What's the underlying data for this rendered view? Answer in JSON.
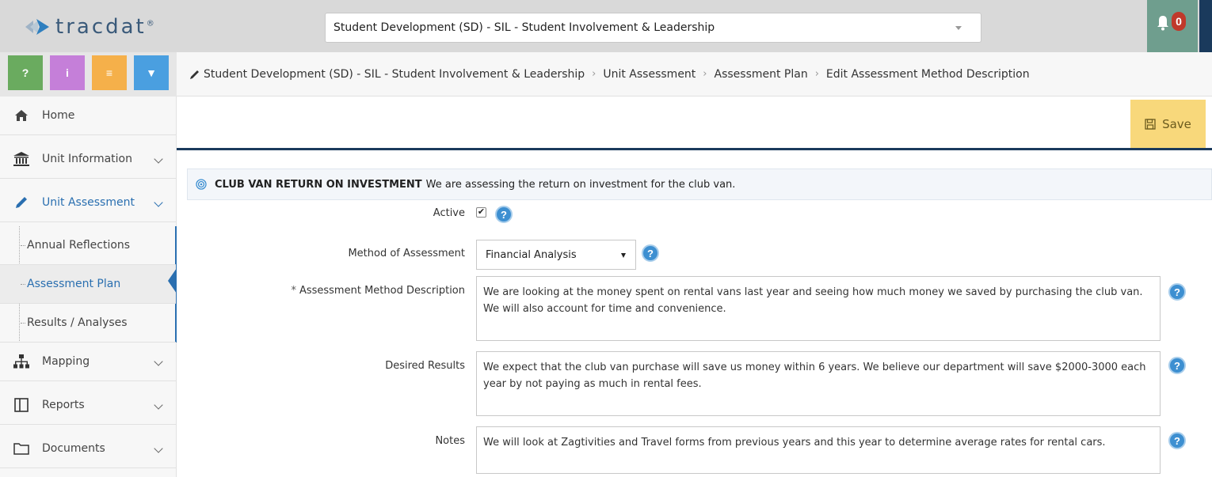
{
  "app": {
    "name": "tracdat",
    "trademark": "®"
  },
  "unit_selector": {
    "value": "Student Development (SD) - SIL - Student Involvement & Leadership"
  },
  "notifications": {
    "count": "0"
  },
  "quick_buttons": [
    {
      "label": "?",
      "color": "#6aab5f"
    },
    {
      "label": "i",
      "color": "#c57fd9"
    },
    {
      "label": "≡",
      "color": "#f5b04a"
    },
    {
      "label": "▼",
      "color": "#4a9fe0"
    }
  ],
  "sidebar": {
    "home": "Home",
    "unit_information": "Unit Information",
    "unit_assessment": "Unit Assessment",
    "sub_items": [
      "Annual Reflections",
      "Assessment Plan",
      "Results / Analyses"
    ],
    "mapping": "Mapping",
    "reports": "Reports",
    "documents": "Documents"
  },
  "breadcrumb": [
    "Student Development (SD) - SIL - Student Involvement & Leadership",
    "Unit Assessment",
    "Assessment Plan",
    "Edit Assessment Method Description"
  ],
  "toolbar": {
    "save_label": "Save"
  },
  "method": {
    "name": "CLUB VAN RETURN ON INVESTMENT",
    "description": "We are assessing the return on investment for the club van."
  },
  "form": {
    "active_label": "Active",
    "active_checked": true,
    "method_label": "Method of Assessment",
    "method_value": "Financial Analysis",
    "description_label": "Assessment Method Description",
    "required_mark": "*",
    "description_value": "We are looking at the money spent on rental vans last year and seeing how much money we saved by purchasing the club van. We will also account for time and convenience.",
    "desired_label": "Desired Results",
    "desired_value": "We expect that the club van purchase will save us money within 6 years. We believe our department will save $2000-3000 each year by not paying as much in rental fees.",
    "notes_label": "Notes",
    "notes_value": "We will look at Zagtivities and Travel forms from previous years and this year to determine average rates for rental cars.",
    "help_symbol": "?"
  },
  "colors": {
    "nav_active": "#2a6fb0",
    "save_button": "#f8d87b",
    "header_rule": "#1a3a5c",
    "help_icon": "#3d8fd1"
  }
}
